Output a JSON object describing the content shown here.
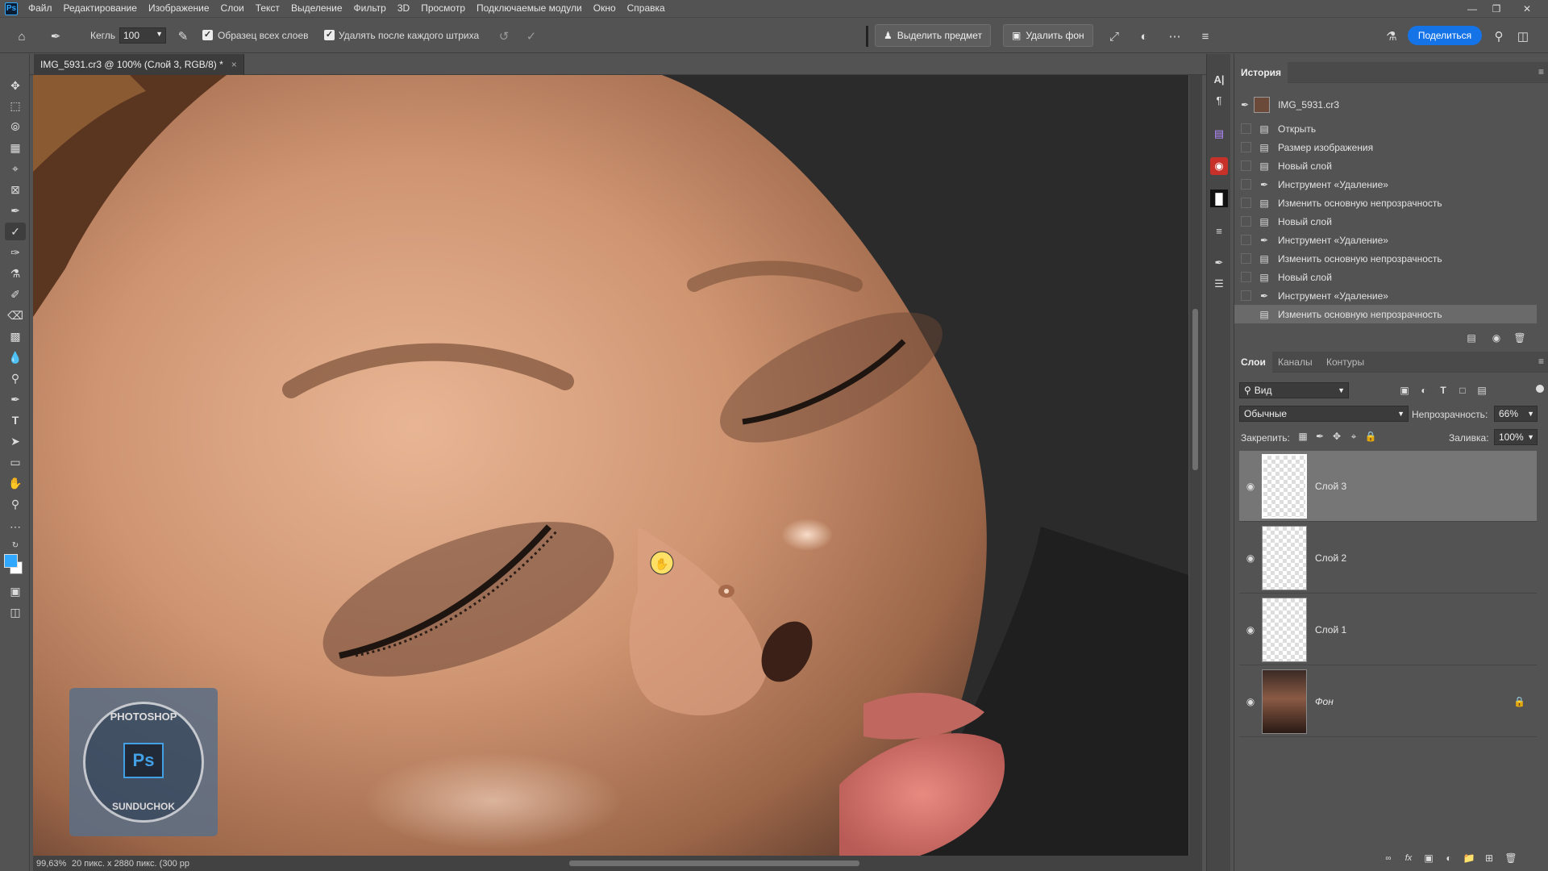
{
  "menubar": {
    "logo": "Ps",
    "items": [
      "Файл",
      "Редактирование",
      "Изображение",
      "Слои",
      "Текст",
      "Выделение",
      "Фильтр",
      "3D",
      "Просмотр",
      "Подключаемые модули",
      "Окно",
      "Справка"
    ]
  },
  "optionsbar": {
    "size_label": "Кегль",
    "size_value": "100",
    "sample_all_layers": "Образец всех слоев",
    "remove_after_stroke": "Удалять после каждого штриха",
    "select_subject": "Выделить предмет",
    "remove_background": "Удалить фон",
    "share": "Поделиться"
  },
  "document": {
    "tab_title": "IMG_5931.cr3 @ 100% (Слой 3, RGB/8) *",
    "zoom": "99,63%",
    "info": "20 пикс. x 2880 пикс. (300 pp"
  },
  "history": {
    "tab": "История",
    "snapshot": "IMG_5931.cr3",
    "items": [
      {
        "label": "Открыть",
        "icon": "doc-icon"
      },
      {
        "label": "Размер изображения",
        "icon": "doc-icon"
      },
      {
        "label": "Новый слой",
        "icon": "doc-icon"
      },
      {
        "label": "Инструмент «Удаление»",
        "icon": "brush-icon"
      },
      {
        "label": "Изменить основную непрозрачность",
        "icon": "doc-icon"
      },
      {
        "label": "Новый слой",
        "icon": "doc-icon"
      },
      {
        "label": "Инструмент «Удаление»",
        "icon": "brush-icon"
      },
      {
        "label": "Изменить основную непрозрачность",
        "icon": "doc-icon"
      },
      {
        "label": "Новый слой",
        "icon": "doc-icon"
      },
      {
        "label": "Инструмент «Удаление»",
        "icon": "brush-icon"
      },
      {
        "label": "Изменить основную непрозрачность",
        "icon": "doc-icon"
      }
    ]
  },
  "layers": {
    "tabs": [
      "Слои",
      "Каналы",
      "Контуры"
    ],
    "filter": "Вид",
    "blend_mode": "Обычные",
    "opacity_label": "Непрозрачность:",
    "opacity_value": "66%",
    "lock_label": "Закрепить:",
    "fill_label": "Заливка:",
    "fill_value": "100%",
    "items": [
      {
        "name": "Слой 3"
      },
      {
        "name": "Слой 2"
      },
      {
        "name": "Слой 1"
      },
      {
        "name": "Фон"
      }
    ]
  },
  "watermark": {
    "top": "PHOTOSHOP",
    "center": "Ps",
    "bottom": "SUNDUCHOK"
  },
  "colors": {
    "accent": "#1473e6",
    "foreground": "#31a8ff",
    "background": "#ffffff"
  }
}
